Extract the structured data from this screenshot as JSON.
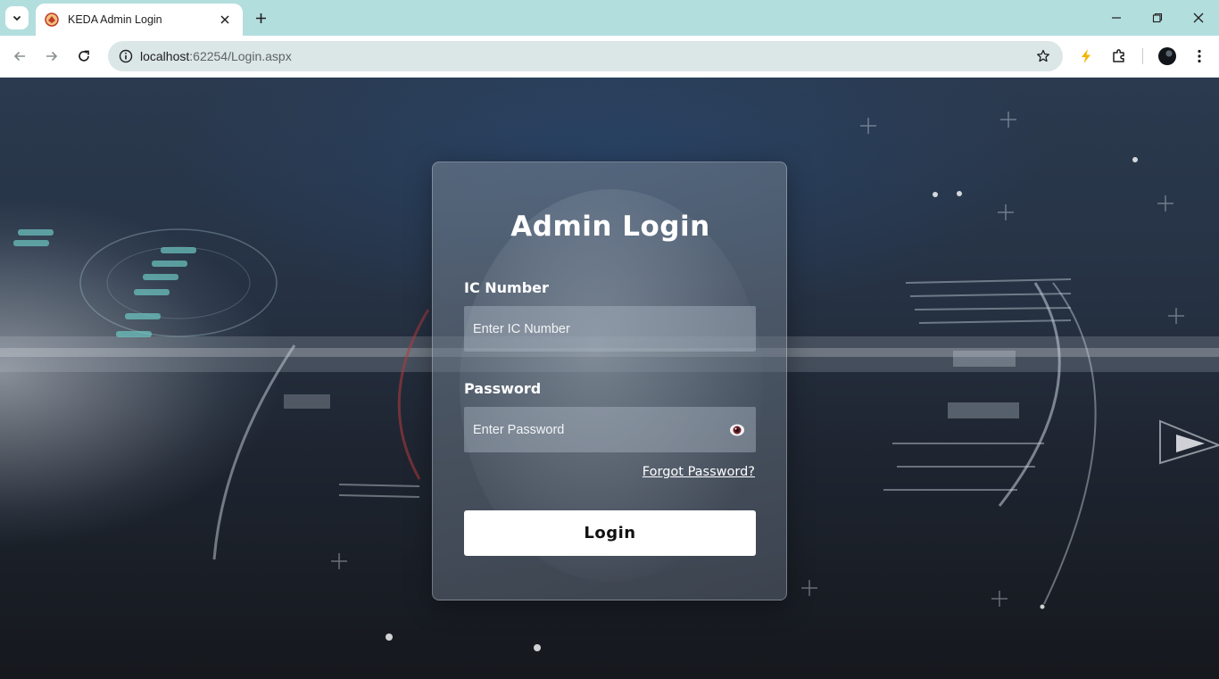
{
  "browser": {
    "tab_title": "KEDA Admin Login",
    "url_host": "localhost",
    "url_path": ":62254/Login.aspx"
  },
  "icons": {
    "tab_menu": "chevron-down-icon",
    "tab_favicon": "app-favicon-icon",
    "tab_close": "close-icon",
    "new_tab": "plus-icon",
    "minimize": "minimize-icon",
    "restore": "restore-icon",
    "close_window": "close-icon",
    "back": "arrow-left-icon",
    "forward": "arrow-right-icon",
    "reload": "reload-icon",
    "site_info": "info-icon",
    "bookmark": "star-icon",
    "extension_bolt": "lightning-icon",
    "extensions": "puzzle-icon",
    "profile": "avatar-icon",
    "menu": "kebab-menu-icon",
    "show_password": "eye-icon"
  },
  "login": {
    "title": "Admin Login",
    "ic_label": "IC Number",
    "ic_placeholder": "Enter IC Number",
    "ic_value": "",
    "password_label": "Password",
    "password_placeholder": "Enter Password",
    "password_value": "",
    "forgot_link": "Forgot Password?",
    "submit_label": "Login"
  },
  "colors": {
    "chrome_bg": "#b3dede",
    "button_bg": "#ffffff",
    "text": "#ffffff"
  }
}
